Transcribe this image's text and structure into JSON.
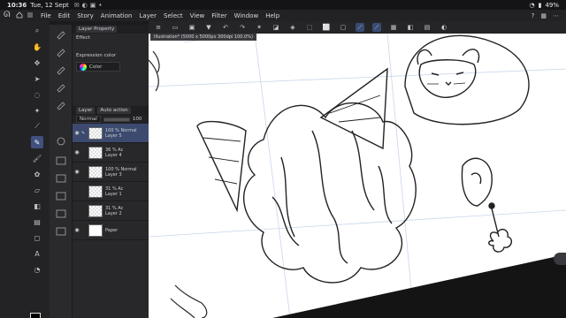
{
  "status": {
    "time": "10:36",
    "date": "Tue, 12 Sept",
    "battery": "49%"
  },
  "menu": {
    "items": [
      "File",
      "Edit",
      "Story",
      "Animation",
      "Layer",
      "Select",
      "View",
      "Filter",
      "Window",
      "Help"
    ]
  },
  "panel": {
    "title": "Layer Property",
    "tab2": "",
    "effect_label": "Effect",
    "expression_label": "Expression color",
    "expression_value": "Color",
    "layer_tab": "Layer",
    "layer_tab2": "Auto action",
    "blend_mode": "Normal",
    "opacity": "100"
  },
  "layers": [
    {
      "blend": "100 % Normal",
      "name": "Layer 5",
      "selected": true,
      "visible": true
    },
    {
      "blend": "36 % Ac",
      "name": "Layer 4",
      "selected": false,
      "visible": true
    },
    {
      "blend": "100 % Normal",
      "name": "Layer 3",
      "selected": false,
      "visible": true
    },
    {
      "blend": "31 % Ac",
      "name": "Layer 1",
      "selected": false,
      "visible": false
    },
    {
      "blend": "31 % Ac",
      "name": "Layer 2",
      "selected": false,
      "visible": false
    },
    {
      "blend": "",
      "name": "Paper",
      "selected": false,
      "visible": true
    }
  ],
  "document": {
    "tab_title": "Illustration* (5000 x 5000px 300dpi 100.0%)"
  },
  "colors": {
    "main": "#000000",
    "sub": "#ffffff",
    "accent": "#3b4a6e"
  }
}
